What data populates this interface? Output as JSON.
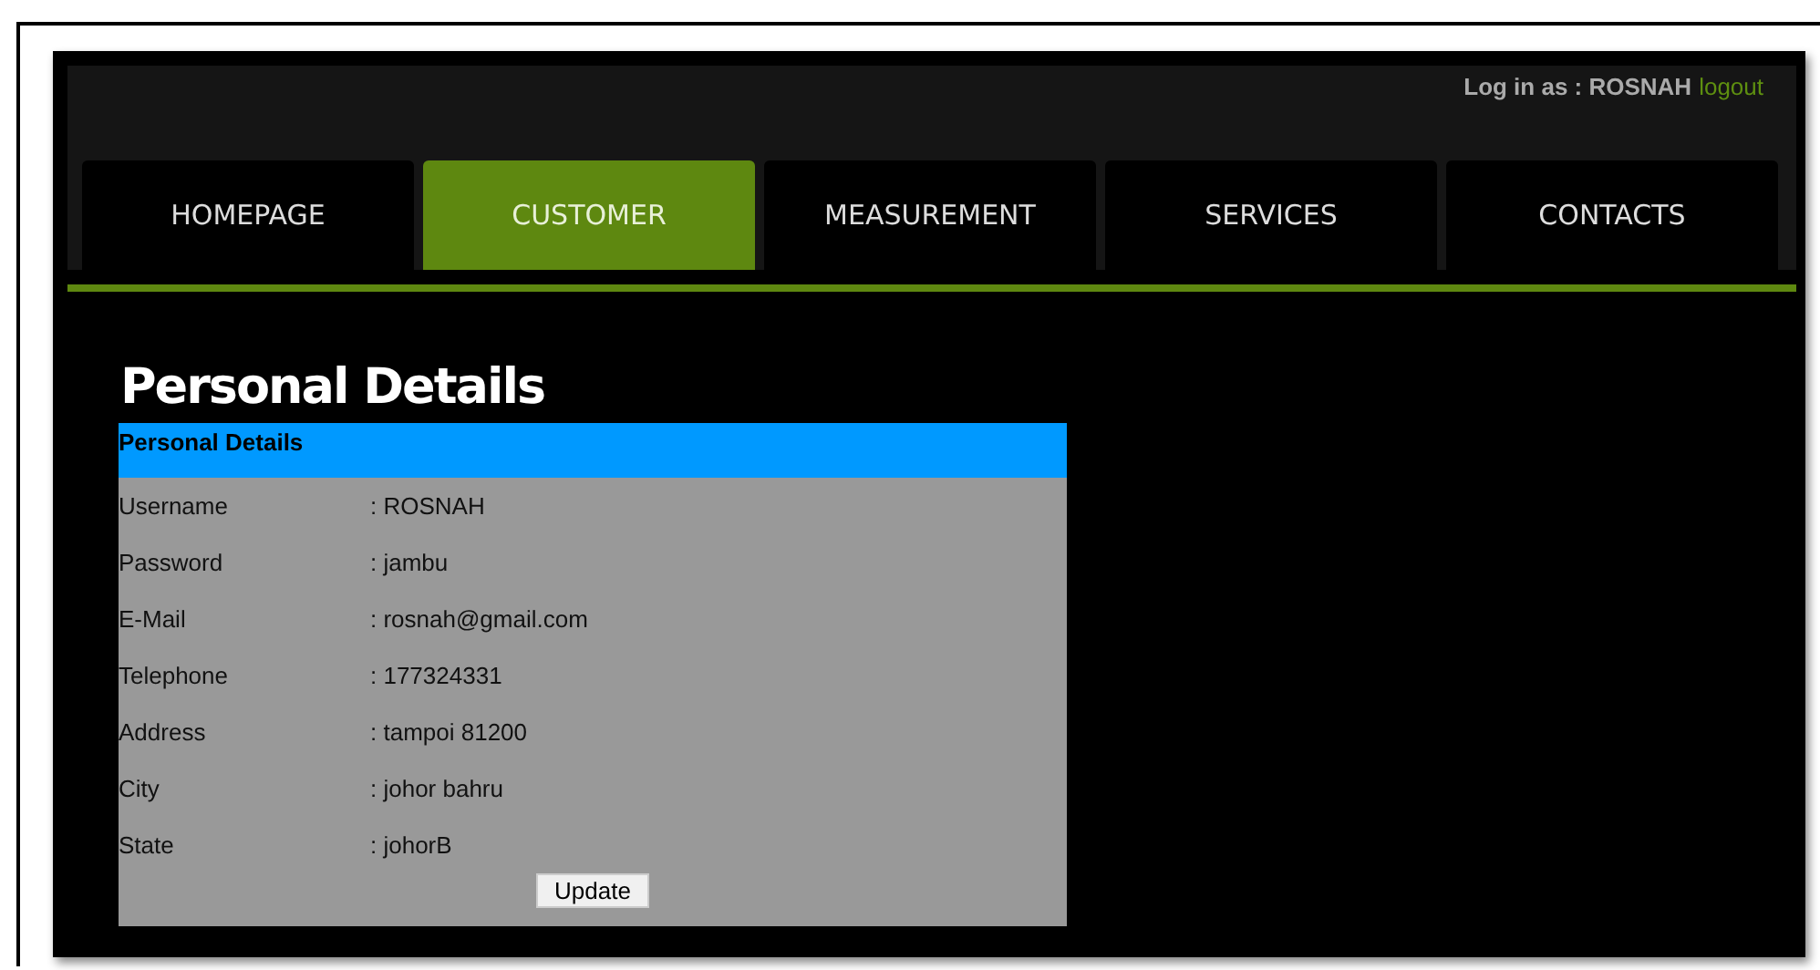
{
  "header": {
    "login_label": "Log in as : ROSNAH",
    "logout_link": "logout"
  },
  "tabs": [
    {
      "label": "HOMEPAGE",
      "selected": false
    },
    {
      "label": "CUSTOMER",
      "selected": true
    },
    {
      "label": "MEASUREMENT",
      "selected": false
    },
    {
      "label": "SERVICES",
      "selected": false
    },
    {
      "label": "CONTACTS",
      "selected": false
    }
  ],
  "page_title": "Personal Details",
  "table": {
    "heading": "Personal Details",
    "rows": [
      {
        "label": "Username",
        "value": ": ROSNAH"
      },
      {
        "label": "Password",
        "value": ": jambu"
      },
      {
        "label": "E-Mail",
        "value": ": rosnah@gmail.com"
      },
      {
        "label": "Telephone",
        "value": ": 177324331"
      },
      {
        "label": "Address",
        "value": ": tampoi 81200"
      },
      {
        "label": "City",
        "value": ": johor bahru"
      },
      {
        "label": "State",
        "value": ": johorB"
      }
    ],
    "button": "Update"
  }
}
